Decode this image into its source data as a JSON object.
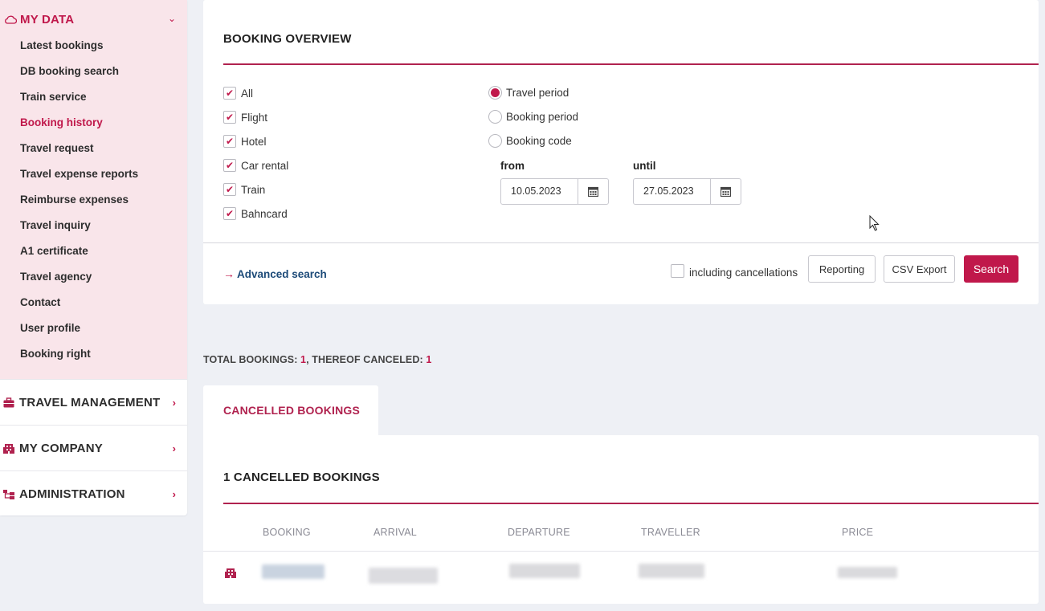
{
  "sidebar": {
    "my_data": {
      "title": "MY DATA",
      "items": [
        {
          "label": "Latest bookings"
        },
        {
          "label": "DB booking search"
        },
        {
          "label": "Train service"
        },
        {
          "label": "Booking history",
          "active": true
        },
        {
          "label": "Travel request"
        },
        {
          "label": "Travel expense reports"
        },
        {
          "label": "Reimburse expenses"
        },
        {
          "label": "Travel inquiry"
        },
        {
          "label": "A1 certificate"
        },
        {
          "label": "Travel agency"
        },
        {
          "label": "Contact"
        },
        {
          "label": "User profile"
        },
        {
          "label": "Booking right"
        }
      ]
    },
    "sections": [
      {
        "label": "TRAVEL MANAGEMENT",
        "icon": "briefcase-icon"
      },
      {
        "label": "MY COMPANY",
        "icon": "building-icon"
      },
      {
        "label": "ADMINISTRATION",
        "icon": "org-chart-icon"
      }
    ]
  },
  "overview": {
    "title": "BOOKING OVERVIEW",
    "checkboxes": [
      {
        "label": "All",
        "checked": true
      },
      {
        "label": "Flight",
        "checked": true
      },
      {
        "label": "Hotel",
        "checked": true
      },
      {
        "label": "Car rental",
        "checked": true
      },
      {
        "label": "Train",
        "checked": true
      },
      {
        "label": "Bahncard",
        "checked": true
      }
    ],
    "radios": [
      {
        "label": "Travel period",
        "selected": true
      },
      {
        "label": "Booking period",
        "selected": false
      },
      {
        "label": "Booking code",
        "selected": false
      }
    ],
    "from_label": "from",
    "from_value": "10.05.2023",
    "until_label": "until",
    "until_value": "27.05.2023",
    "advanced_search": "Advanced search",
    "including_cancellations": "including cancellations",
    "reporting_button": "Reporting",
    "csv_button": "CSV Export",
    "search_button": "Search"
  },
  "totals": {
    "total_label": "TOTAL BOOKINGS: ",
    "total_value": "1",
    "canceled_label": ", THEREOF CANCELED: ",
    "canceled_value": "1"
  },
  "tab": {
    "label": "CANCELLED BOOKINGS"
  },
  "results": {
    "title": "1 CANCELLED BOOKINGS",
    "columns": [
      "BOOKING",
      "ARRIVAL",
      "DEPARTURE",
      "TRAVELLER",
      "PRICE"
    ]
  },
  "colors": {
    "accent": "#c0184b",
    "link": "#1c4a78",
    "sidebar_bg": "#f9e5ea"
  }
}
